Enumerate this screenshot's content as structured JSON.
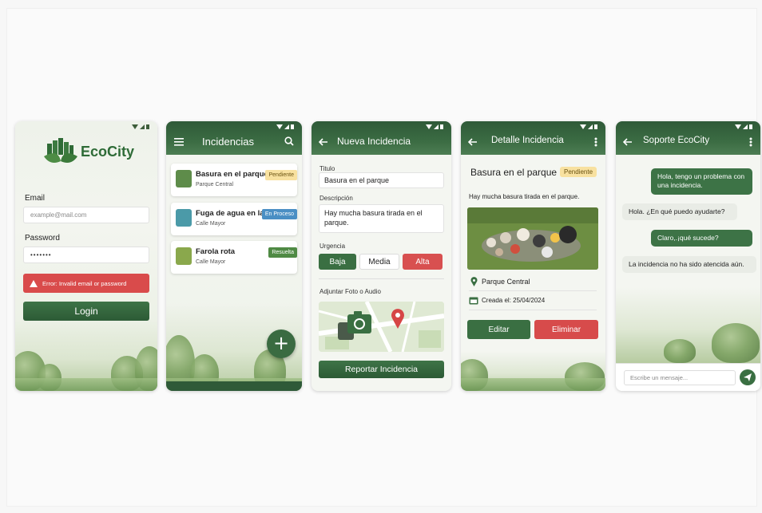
{
  "login": {
    "brand": "EcoCity",
    "email_label": "Email",
    "email_placeholder": "example@mail.com",
    "password_label": "Password",
    "password_value": "•••••••",
    "error_text": "Error: Invalid email or password",
    "login_button": "Login"
  },
  "incidents": {
    "title": "Incidencias",
    "items": [
      {
        "title": "Basura en el parque",
        "subtitle": "Parque Central",
        "status": "Pendiente"
      },
      {
        "title": "Fuga de agua en la",
        "subtitle": "Calle Mayor",
        "status": "En Proceso"
      },
      {
        "title": "Farola rota",
        "subtitle": "Calle Mayor",
        "status": "Resuelta"
      }
    ],
    "fab_label": "+"
  },
  "new_incident": {
    "title": "Nueva Incidencia",
    "title_label": "Titulo",
    "title_value": "Basura en el parque",
    "desc_label": "Descripción",
    "desc_value": "Hay mucha basura tirada en el parque.",
    "urgency_label": "Urgencia",
    "urgency_options": [
      "Baja",
      "Media",
      "Alta"
    ],
    "attach_label": "Adjuntar Foto o Audio",
    "submit_button": "Reportar Incidencia"
  },
  "detail": {
    "title": "Detalle Incidencia",
    "incident_title": "Basura en el parque",
    "status": "Pendiente",
    "description": "Hay mucha basura tirada en el parque.",
    "location": "Parque Central",
    "created": "Creada el: 25/04/2024",
    "edit_button": "Editar",
    "delete_button": "Eliminar"
  },
  "support": {
    "title": "Soporte EcoCity",
    "messages": [
      {
        "from": "me",
        "text": "Hola, tengo un problema con una incidencia."
      },
      {
        "from": "them",
        "text": "Hola. ¿En qué puedo ayudarte?"
      },
      {
        "from": "me",
        "text": "Claro,.¡qué sucede?"
      },
      {
        "from": "them",
        "text": "La incidencia no ha sido atencida aún."
      }
    ],
    "input_placeholder": "Escribe un mensaje..."
  },
  "colors": {
    "primary": "#3a6f42",
    "danger": "#d74b4b",
    "pending": "#f8e1a0",
    "processing": "#4a8fc4",
    "resolved": "#4f8a44"
  }
}
